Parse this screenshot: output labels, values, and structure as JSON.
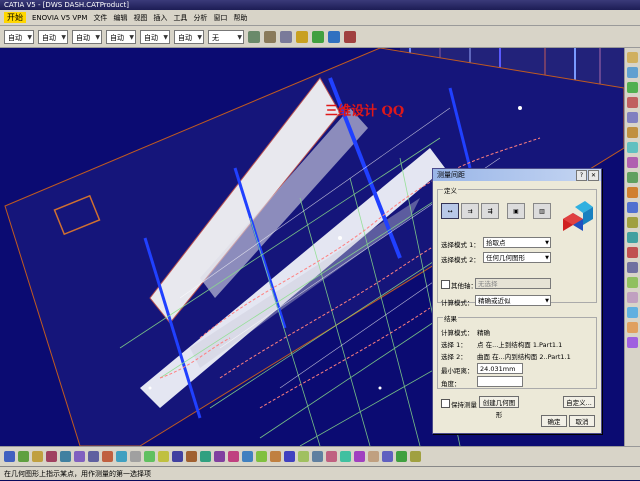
{
  "window": {
    "title": "CATIA V5 - [DWS DASH.CATProduct]"
  },
  "menu": {
    "start": "开始",
    "items": [
      "ENOVIA V5 VPM",
      "文件",
      "编辑",
      "视图",
      "插入",
      "工具",
      "分析",
      "窗口",
      "帮助"
    ]
  },
  "toolbar": {
    "combos": [
      "自动",
      "自动",
      "自动",
      "自动",
      "自动",
      "自动",
      "无"
    ]
  },
  "watermark": {
    "text": "三维设计 QQ"
  },
  "dialog": {
    "title": "测量间距",
    "definition_label": "定义",
    "selection1_mode_label": "选择模式 1：",
    "selection1_mode_value": "拾取点",
    "selection2_mode_label": "选择模式 2：",
    "selection2_mode_value": "任何几何图形",
    "other_axis_label": "其他轴：",
    "other_axis_value": "无选择",
    "calc_mode_label": "计算模式：",
    "calc_mode_value": "精确或近似",
    "result_label": "结果",
    "result_calc_mode_label": "计算模式：",
    "result_calc_mode_value": "精确",
    "result_sel1_label": "选择 1：",
    "result_sel1_value": "点 在...上到结构面 1.Part1.1",
    "result_sel2_label": "选择 2：",
    "result_sel2_value": "曲面 在...内到结构面 2..Part1.1",
    "min_distance_label": "最小距离：",
    "min_distance_value": "24.031mm",
    "angle_label": "角度：",
    "angle_value": "",
    "keep_measure_label": "保持测量",
    "create_geometry_label": "创建几何图形",
    "customize_label": "自定义...",
    "ok_label": "确定",
    "cancel_label": "取消"
  },
  "statusbar": {
    "text": "在几何图形上指示某点，用作测量的第一选择项"
  }
}
